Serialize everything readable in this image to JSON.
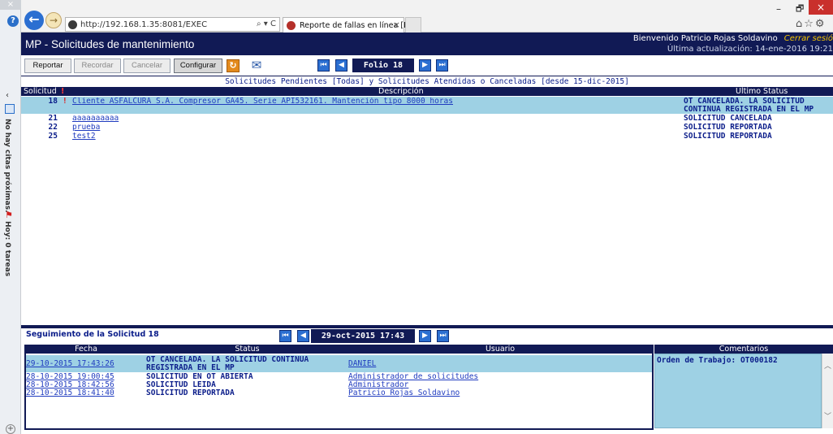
{
  "browser": {
    "url": "http://192.168.1.35:8081/EXEC",
    "tab_title": "Reporte de fallas en línea [P...",
    "window_close": "×",
    "window_max": "🗗",
    "window_min": "–",
    "right_icons": "⌂☆⚙",
    "addr_icons": "⌕ ▾ C"
  },
  "sidebar": {
    "agenda_text": "No hay citas próximas.",
    "tasks_text": "Hoy: 0 tareas"
  },
  "header": {
    "title": "MP - Solicitudes de mantenimiento",
    "welcome": "Bienvenido Patricio Rojas Soldavino",
    "logout": "Cerrar sesió",
    "last_update": "Última actualización: 14-ene-2016 19:21"
  },
  "toolbar": {
    "report_label": "Reportar",
    "remind_label": "Recordar",
    "cancel_label": "Cancelar",
    "config_label": "Configurar",
    "folio_label": "Folio 18",
    "nav_first": "⏮",
    "nav_prev": "◀",
    "nav_next": "▶",
    "nav_last": "⏭"
  },
  "list": {
    "caption": "Solicitudes Pendientes [Todas] y Solicitudes Atendidas o Canceladas [desde 15-dic-2015]",
    "headers": {
      "solicitud": "Solicitud",
      "flag": "!",
      "description": "Descripción",
      "status": "Último Status"
    },
    "rows": [
      {
        "num": "18",
        "flag": "!",
        "description": "Cliente ASFALCURA S.A. Compresor GA45. Serie API532161. Mantención tipo 8000 horas",
        "status": "OT CANCELADA. LA SOLICITUD CONTINUA REGISTRADA EN EL MP"
      },
      {
        "num": "21",
        "flag": "",
        "description": "aaaaaaaaaa",
        "status": "SOLICITUD CANCELADA"
      },
      {
        "num": "22",
        "flag": "",
        "description": "prueba",
        "status": "SOLICITUD REPORTADA"
      },
      {
        "num": "25",
        "flag": "",
        "description": "test2",
        "status": "SOLICITUD REPORTADA"
      }
    ]
  },
  "tracking": {
    "title": "Seguimiento de la Solicitud 18",
    "date_label": "29-oct-2015 17:43",
    "headers": {
      "fecha": "Fecha",
      "status": "Status",
      "usuario": "Usuario",
      "comentarios": "Comentarios"
    },
    "rows": [
      {
        "fecha": "29-10-2015 17:43:26",
        "status": "OT CANCELADA. LA SOLICITUD CONTINUA REGISTRADA EN EL MP",
        "usuario": "DANIEL"
      },
      {
        "fecha": "28-10-2015 19:00:45",
        "status": "SOLICITUD EN OT ABIERTA",
        "usuario": "Administrador de solicitudes"
      },
      {
        "fecha": "28-10-2015 18:42:56",
        "status": "SOLICITUD LEIDA",
        "usuario": "Administrador"
      },
      {
        "fecha": "28-10-2015 18:41:40",
        "status": "SOLICITUD REPORTADA",
        "usuario": "Patricio Rojas Soldavino"
      }
    ],
    "comment": "Orden de Trabajo: OT000182"
  }
}
